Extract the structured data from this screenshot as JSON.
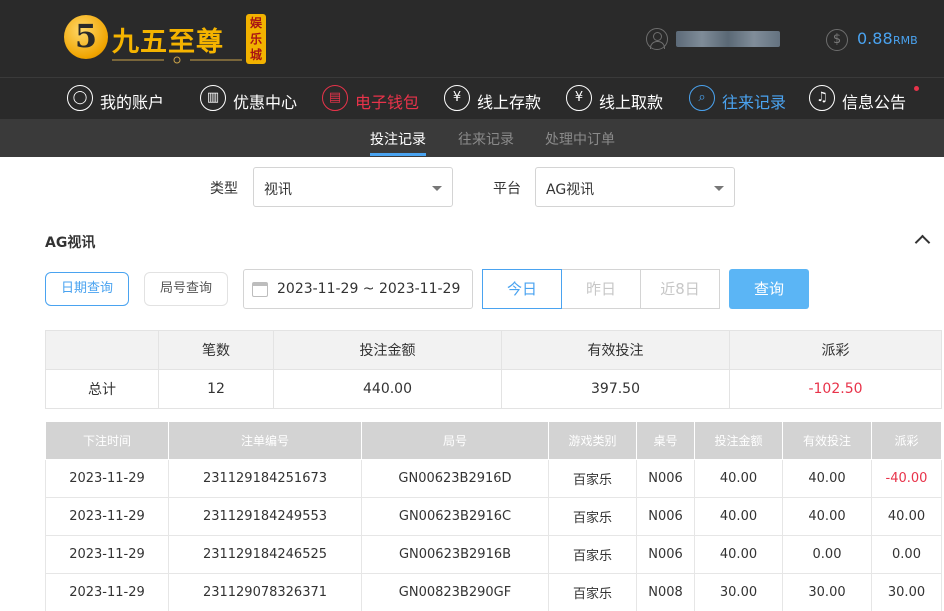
{
  "header": {
    "logo_digit": "5",
    "logo_text": "九五至尊",
    "logo_badge": "娱乐城",
    "balance_amount": "0.88",
    "balance_unit": "RMB"
  },
  "nav": {
    "items": [
      {
        "label": "我的账户",
        "icon": "user-icon"
      },
      {
        "label": "优惠中心",
        "icon": "gift-icon"
      },
      {
        "label": "电子钱包",
        "icon": "wallet-icon"
      },
      {
        "label": "线上存款",
        "icon": "deposit-icon"
      },
      {
        "label": "线上取款",
        "icon": "withdraw-icon"
      },
      {
        "label": "往来记录",
        "icon": "records-icon"
      },
      {
        "label": "信息公告",
        "icon": "bell-icon"
      }
    ]
  },
  "subnav": {
    "tabs": [
      "投注记录",
      "往来记录",
      "处理中订单"
    ]
  },
  "filters": {
    "type_label": "类型",
    "type_value": "视讯",
    "platform_label": "平台",
    "platform_value": "AG视讯"
  },
  "section": {
    "title": "AG视讯",
    "date_query": "日期查询",
    "round_query": "局号查询",
    "date_range": "2023-11-29 ~ 2023-11-29",
    "quick": [
      "今日",
      "昨日",
      "近8日"
    ],
    "query_button": "查询"
  },
  "summary": {
    "headers": [
      "",
      "笔数",
      "投注金额",
      "有效投注",
      "派彩"
    ],
    "total_label": "总计",
    "count": "12",
    "bet_amount": "440.00",
    "valid_bet": "397.50",
    "payout": "-102.50"
  },
  "records": {
    "headers": [
      "下注时间",
      "注单编号",
      "局号",
      "游戏类别",
      "桌号",
      "投注金额",
      "有效投注",
      "派彩"
    ],
    "rows": [
      [
        "2023-11-29",
        "231129184251673",
        "GN00623B2916D",
        "百家乐",
        "N006",
        "40.00",
        "40.00",
        "-40.00"
      ],
      [
        "2023-11-29",
        "231129184249553",
        "GN00623B2916C",
        "百家乐",
        "N006",
        "40.00",
        "40.00",
        "40.00"
      ],
      [
        "2023-11-29",
        "231129184246525",
        "GN00623B2916B",
        "百家乐",
        "N006",
        "40.00",
        "0.00",
        "0.00"
      ],
      [
        "2023-11-29",
        "231129078326371",
        "GN00823B290GF",
        "百家乐",
        "N008",
        "30.00",
        "30.00",
        "30.00"
      ]
    ]
  },
  "colors": {
    "accent_blue": "#4aa3f0",
    "accent_red": "#e8334a",
    "header_bg": "#2a2a2a"
  }
}
